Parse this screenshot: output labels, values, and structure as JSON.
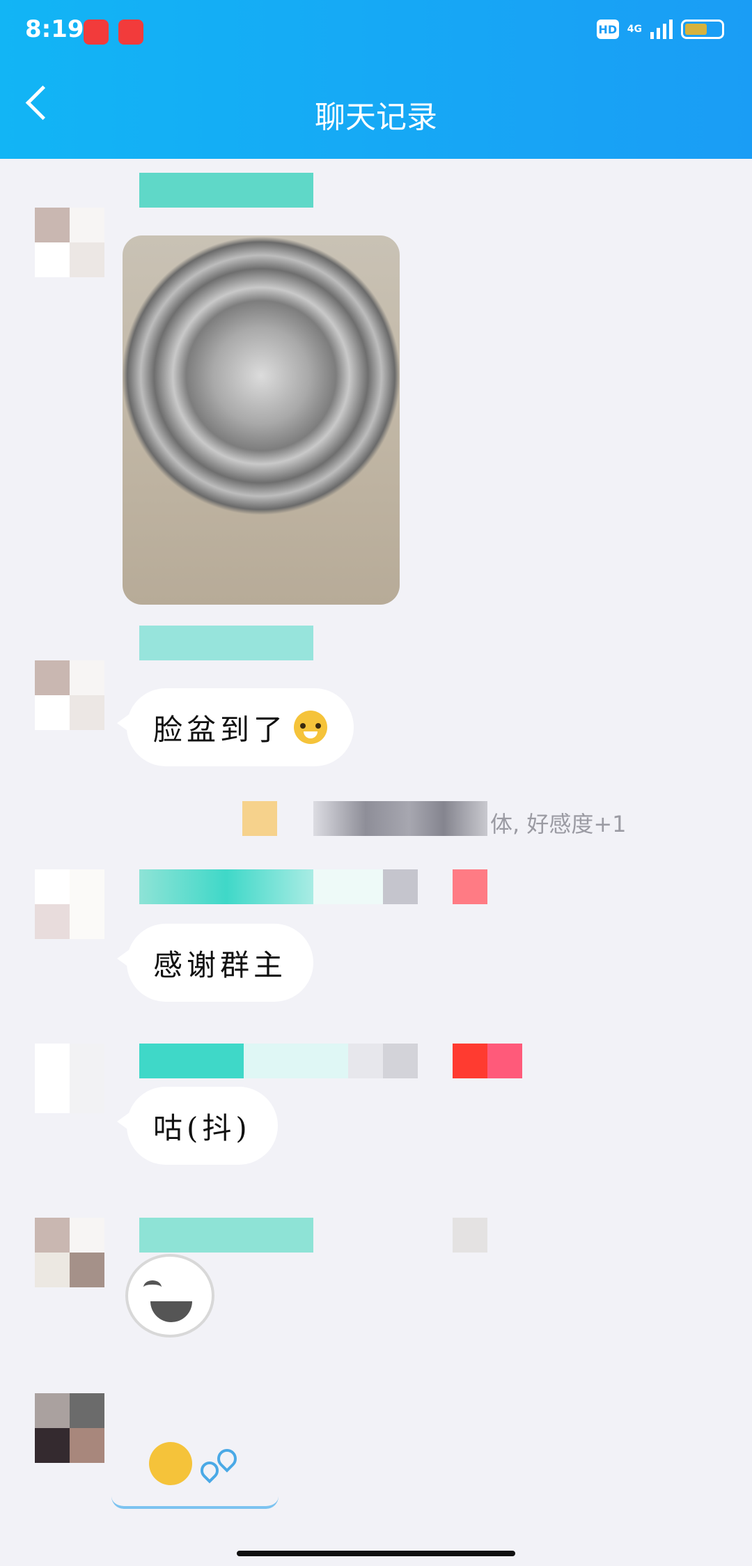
{
  "status_bar": {
    "time": "8:19",
    "hd": "HD",
    "network": "4G"
  },
  "header": {
    "title": "聊天记录"
  },
  "messages": [
    {
      "type": "image"
    },
    {
      "type": "text",
      "text": "脸盆到了"
    },
    {
      "type": "system",
      "text": "体, 好感度+1"
    },
    {
      "type": "text",
      "text": "感谢群主"
    },
    {
      "type": "text",
      "text": "咕(抖)"
    },
    {
      "type": "sticker"
    },
    {
      "type": "sticker"
    }
  ],
  "colors": {
    "header": "#1a9df5",
    "background": "#f2f2f7",
    "bubble": "#ffffff"
  }
}
